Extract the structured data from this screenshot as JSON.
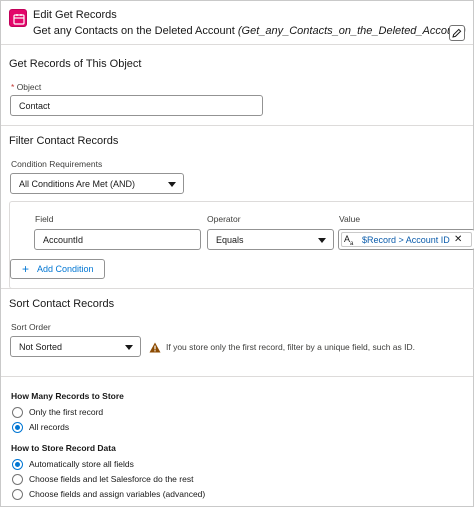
{
  "header": {
    "title": "Edit Get Records",
    "subtitle": "Get any Contacts on the Deleted Account",
    "api_name": "(Get_any_Contacts_on_the_Deleted_Account)"
  },
  "object_section": {
    "title": "Get Records of This Object",
    "object_label": "Object",
    "object_value": "Contact"
  },
  "filter_section": {
    "title": "Filter Contact Records",
    "condition_label": "Condition Requirements",
    "condition_value": "All Conditions Are Met (AND)",
    "field_header": "Field",
    "operator_header": "Operator",
    "value_header": "Value",
    "field_value": "AccountId",
    "operator_value": "Equals",
    "value_text": "$Record > Account ID",
    "add_condition": "Add Condition"
  },
  "sort_section": {
    "title": "Sort Contact Records",
    "sort_label": "Sort Order",
    "sort_value": "Not Sorted",
    "warning": "If you store only the first record, filter by a unique field, such as ID."
  },
  "store_section": {
    "how_many_label": "How Many Records to Store",
    "how_many_options": [
      "Only the first record",
      "All records"
    ],
    "how_many_selected": 1,
    "how_store_label": "How to Store Record Data",
    "how_store_options": [
      "Automatically store all fields",
      "Choose fields and let Salesforce do the rest",
      "Choose fields and assign variables (advanced)"
    ],
    "how_store_selected": 0
  },
  "colors": {
    "accent": "#0176d3",
    "icon_bg": "#e3066a",
    "warning": "#8c4b02"
  },
  "icons": [
    "get-records-icon",
    "pencil-icon",
    "chevron-down-icon",
    "plus-icon",
    "warning-icon",
    "text-type-icon",
    "close-icon"
  ]
}
